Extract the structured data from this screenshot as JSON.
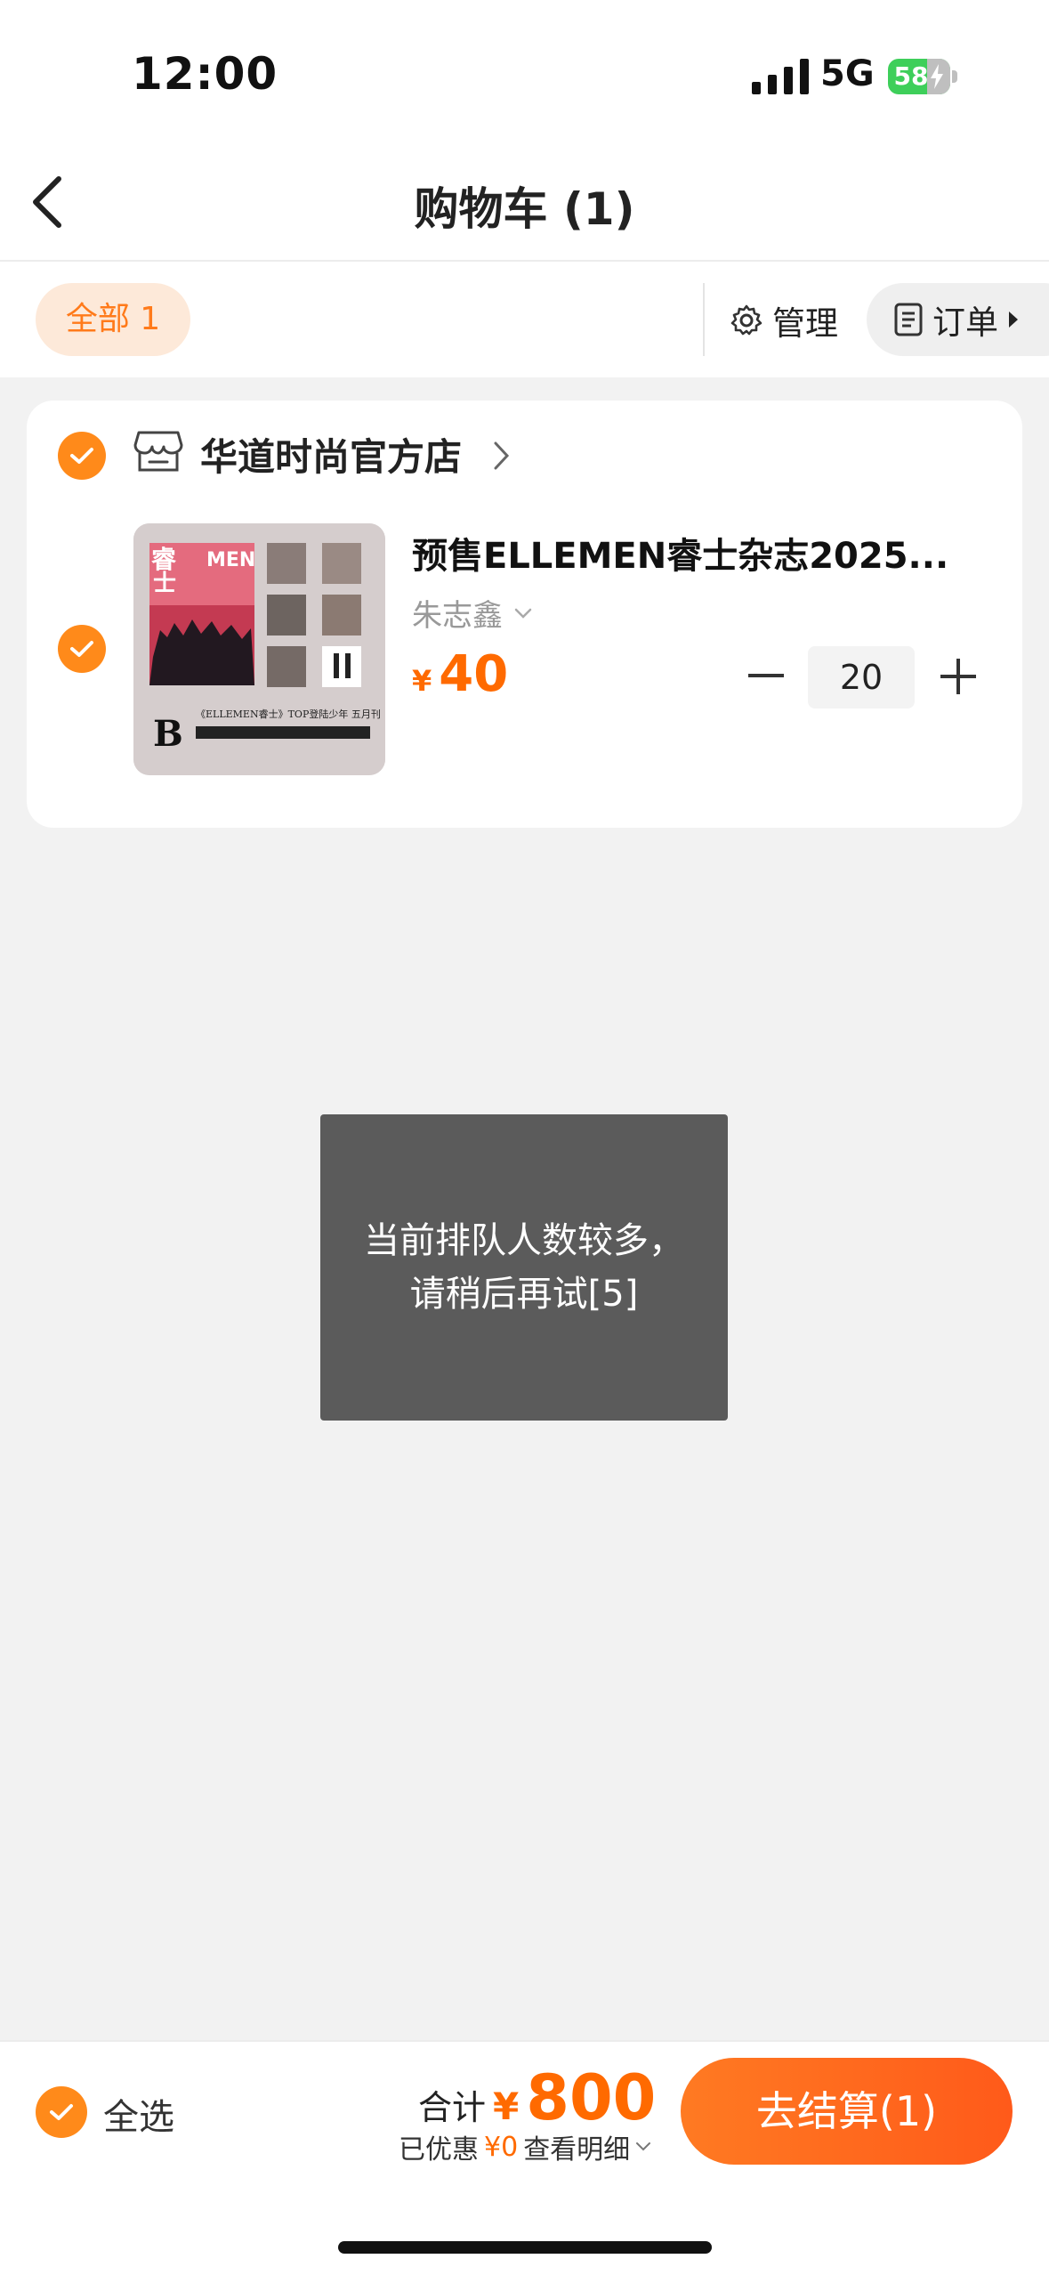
{
  "status_bar": {
    "time": "12:00",
    "network": "5G",
    "battery": "58"
  },
  "header": {
    "title": "购物车 (1)"
  },
  "filter_bar": {
    "all_chip": "全部 1",
    "manage_label": "管理",
    "orders_label": "订单"
  },
  "store": {
    "name": "华道时尚官方店"
  },
  "item": {
    "title": "预售ELLEMEN睿士杂志2025...",
    "variant": "朱志鑫",
    "price_symbol": "¥",
    "price": "40",
    "quantity": "20",
    "cover_text_1": "《ELLEMEN睿士》TOP登陆少年 五月刊",
    "cover_text_2": "B"
  },
  "toast": {
    "line1": "当前排队人数较多，",
    "line2": "请稍后再试[5]"
  },
  "bottom_bar": {
    "select_all_label": "全选",
    "total_label": "合计",
    "total_symbol": "¥",
    "total_value": "800",
    "discount_label": "已优惠",
    "discount_value": "¥0",
    "details_label": "查看明细",
    "checkout_label": "去结算(1)"
  },
  "colors": {
    "accent": "#ff6a00",
    "check": "#ff8a1a",
    "chip_bg": "#fde9d9",
    "toast_bg": "#5b5b5b"
  }
}
